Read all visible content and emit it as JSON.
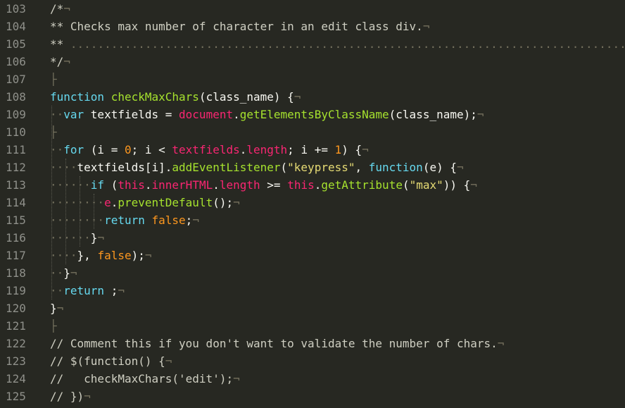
{
  "editor": {
    "lines": [
      {
        "num": "103",
        "tokens": [
          {
            "t": "/*",
            "c": "comment"
          },
          {
            "t": "¬",
            "c": "invis"
          }
        ]
      },
      {
        "num": "104",
        "tokens": [
          {
            "t": "** Checks max number of character in an edit class div.",
            "c": "comment"
          },
          {
            "t": "¬",
            "c": "invis"
          }
        ]
      },
      {
        "num": "105",
        "tokens": [
          {
            "t": "** ",
            "c": "comment"
          },
          {
            "t": "...................................................................................",
            "c": "invis"
          }
        ]
      },
      {
        "num": "106",
        "tokens": [
          {
            "t": "*/",
            "c": "comment"
          },
          {
            "t": "¬",
            "c": "invis"
          }
        ]
      },
      {
        "num": "107",
        "tokens": [
          {
            "t": "├",
            "c": "invis"
          }
        ]
      },
      {
        "num": "108",
        "tokens": [
          {
            "t": "function ",
            "c": "keyword"
          },
          {
            "t": "checkMaxChars",
            "c": "function"
          },
          {
            "t": "(class_name) {",
            "c": "ident"
          },
          {
            "t": "¬",
            "c": "invis"
          }
        ]
      },
      {
        "num": "109",
        "tokens": [
          {
            "t": "··",
            "c": "invis"
          },
          {
            "t": "var ",
            "c": "keyword"
          },
          {
            "t": "textfields = ",
            "c": "ident"
          },
          {
            "t": "document",
            "c": "obj"
          },
          {
            "t": ".",
            "c": "ident"
          },
          {
            "t": "getElementsByClassName",
            "c": "method"
          },
          {
            "t": "(class_name);",
            "c": "ident"
          },
          {
            "t": "¬",
            "c": "invis"
          }
        ]
      },
      {
        "num": "110",
        "tokens": [
          {
            "t": "├",
            "c": "invis"
          }
        ]
      },
      {
        "num": "111",
        "tokens": [
          {
            "t": "··",
            "c": "invis"
          },
          {
            "t": "for ",
            "c": "keyword"
          },
          {
            "t": "(i = ",
            "c": "ident"
          },
          {
            "t": "0",
            "c": "number"
          },
          {
            "t": "; i < ",
            "c": "ident"
          },
          {
            "t": "textfields",
            "c": "obj"
          },
          {
            "t": ".",
            "c": "ident"
          },
          {
            "t": "length",
            "c": "obj"
          },
          {
            "t": "; i += ",
            "c": "ident"
          },
          {
            "t": "1",
            "c": "number"
          },
          {
            "t": ") {",
            "c": "ident"
          },
          {
            "t": "¬",
            "c": "invis"
          }
        ]
      },
      {
        "num": "112",
        "tokens": [
          {
            "t": "····",
            "c": "invis"
          },
          {
            "t": "textfields[i].",
            "c": "ident"
          },
          {
            "t": "addEventListener",
            "c": "method"
          },
          {
            "t": "(",
            "c": "ident"
          },
          {
            "t": "\"keypress\"",
            "c": "string"
          },
          {
            "t": ", ",
            "c": "ident"
          },
          {
            "t": "function",
            "c": "keyword"
          },
          {
            "t": "(e) {",
            "c": "ident"
          },
          {
            "t": "¬",
            "c": "invis"
          }
        ]
      },
      {
        "num": "113",
        "tokens": [
          {
            "t": "······",
            "c": "invis"
          },
          {
            "t": "if ",
            "c": "keyword"
          },
          {
            "t": "(",
            "c": "ident"
          },
          {
            "t": "this",
            "c": "this"
          },
          {
            "t": ".",
            "c": "ident"
          },
          {
            "t": "innerHTML",
            "c": "obj"
          },
          {
            "t": ".",
            "c": "ident"
          },
          {
            "t": "length",
            "c": "obj"
          },
          {
            "t": " >= ",
            "c": "ident"
          },
          {
            "t": "this",
            "c": "this"
          },
          {
            "t": ".",
            "c": "ident"
          },
          {
            "t": "getAttribute",
            "c": "method"
          },
          {
            "t": "(",
            "c": "ident"
          },
          {
            "t": "\"max\"",
            "c": "string"
          },
          {
            "t": ")) {",
            "c": "ident"
          },
          {
            "t": "¬",
            "c": "invis"
          }
        ]
      },
      {
        "num": "114",
        "tokens": [
          {
            "t": "········",
            "c": "invis"
          },
          {
            "t": "e",
            "c": "obj"
          },
          {
            "t": ".",
            "c": "ident"
          },
          {
            "t": "preventDefault",
            "c": "method"
          },
          {
            "t": "();",
            "c": "ident"
          },
          {
            "t": "¬",
            "c": "invis"
          }
        ]
      },
      {
        "num": "115",
        "tokens": [
          {
            "t": "········",
            "c": "invis"
          },
          {
            "t": "return ",
            "c": "keyword"
          },
          {
            "t": "false",
            "c": "bool"
          },
          {
            "t": ";",
            "c": "ident"
          },
          {
            "t": "¬",
            "c": "invis"
          }
        ]
      },
      {
        "num": "116",
        "tokens": [
          {
            "t": "······",
            "c": "invis"
          },
          {
            "t": "}",
            "c": "ident"
          },
          {
            "t": "¬",
            "c": "invis"
          }
        ]
      },
      {
        "num": "117",
        "tokens": [
          {
            "t": "····",
            "c": "invis"
          },
          {
            "t": "}, ",
            "c": "ident"
          },
          {
            "t": "false",
            "c": "bool"
          },
          {
            "t": ");",
            "c": "ident"
          },
          {
            "t": "¬",
            "c": "invis"
          }
        ]
      },
      {
        "num": "118",
        "tokens": [
          {
            "t": "··",
            "c": "invis"
          },
          {
            "t": "}",
            "c": "ident"
          },
          {
            "t": "¬",
            "c": "invis"
          }
        ]
      },
      {
        "num": "119",
        "tokens": [
          {
            "t": "··",
            "c": "invis"
          },
          {
            "t": "return ",
            "c": "keyword"
          },
          {
            "t": ";",
            "c": "ident"
          },
          {
            "t": "¬",
            "c": "invis"
          }
        ]
      },
      {
        "num": "120",
        "tokens": [
          {
            "t": "}",
            "c": "ident"
          },
          {
            "t": "¬",
            "c": "invis"
          }
        ]
      },
      {
        "num": "121",
        "tokens": [
          {
            "t": "├",
            "c": "invis"
          }
        ]
      },
      {
        "num": "122",
        "tokens": [
          {
            "t": "// Comment this if you don't want to validate the number of chars.",
            "c": "comment"
          },
          {
            "t": "¬",
            "c": "invis"
          }
        ]
      },
      {
        "num": "123",
        "tokens": [
          {
            "t": "// $(function() {",
            "c": "comment"
          },
          {
            "t": "¬",
            "c": "invis"
          }
        ]
      },
      {
        "num": "124",
        "tokens": [
          {
            "t": "//   checkMaxChars('edit');",
            "c": "comment"
          },
          {
            "t": "¬",
            "c": "invis"
          }
        ]
      },
      {
        "num": "125",
        "tokens": [
          {
            "t": "// })",
            "c": "comment"
          },
          {
            "t": "¬",
            "c": "invis"
          }
        ]
      }
    ]
  },
  "colors": {
    "background": "#272822",
    "gutter_text": "#8f908a",
    "comment": "#cfcfc2",
    "keyword": "#66d9ef",
    "function": "#a6e22e",
    "string": "#e6db74",
    "number": "#fd971f",
    "object": "#f92672"
  }
}
